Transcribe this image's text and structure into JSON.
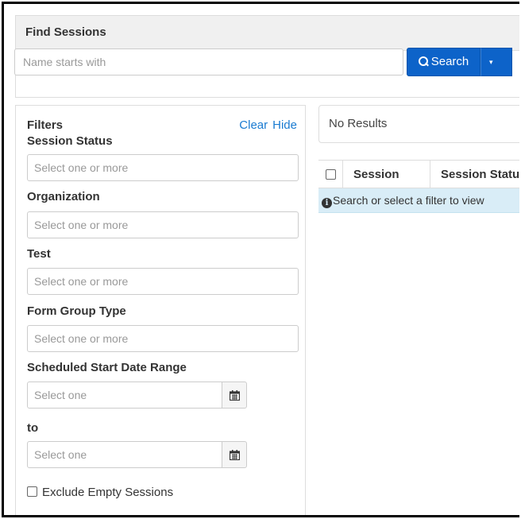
{
  "find_sessions": {
    "title": "Find Sessions",
    "search_placeholder": "Name starts with",
    "search_button_label": "Search",
    "search_caret": "▾"
  },
  "filters": {
    "title": "Filters",
    "clear_label": "Clear",
    "hide_label": "Hide",
    "session_status_label": "Session Status",
    "session_status_placeholder": "Select one or more",
    "organization_label": "Organization",
    "organization_placeholder": "Select one or more",
    "test_label": "Test",
    "test_placeholder": "Select one or more",
    "form_group_type_label": "Form Group Type",
    "form_group_type_placeholder": "Select one or more",
    "date_range_label": "Scheduled Start Date Range",
    "start_date_placeholder": "Select one",
    "to_label": "to",
    "end_date_placeholder": "Select one",
    "exclude_empty_label": "Exclude Empty Sessions",
    "exclude_empty_checked": false
  },
  "results": {
    "status": "No Results",
    "columns": [
      "Session",
      "Session Status"
    ],
    "info_message": "Search or select a filter to view"
  },
  "icons": {
    "search": "search-icon",
    "calendar": "calendar-icon",
    "info": "info-icon"
  }
}
